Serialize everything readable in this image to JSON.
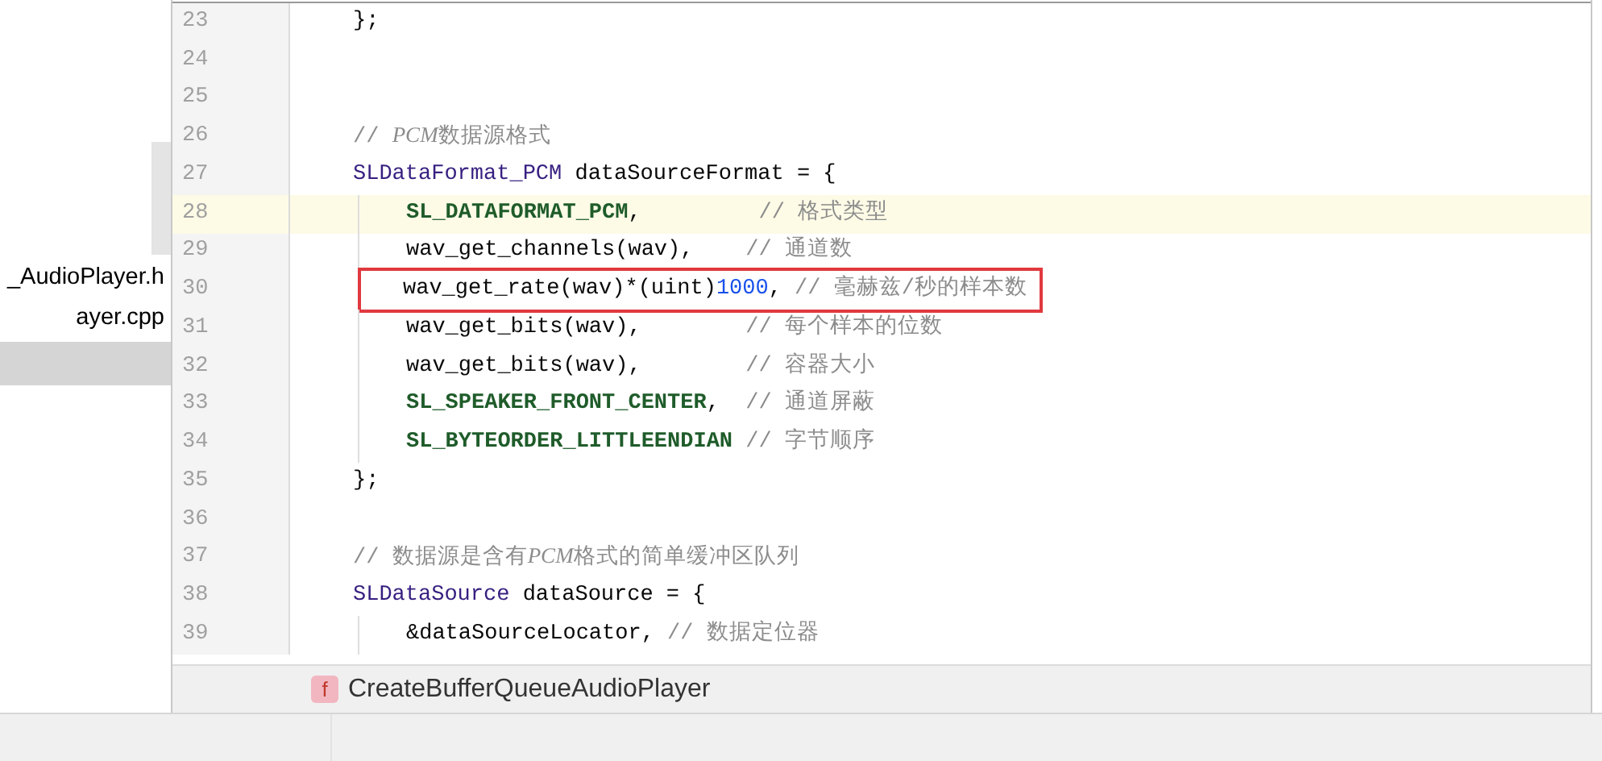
{
  "sidebar": {
    "items": [
      {
        "label": "_AudioPlayer.h",
        "selected": false
      },
      {
        "label": "ayer.cpp",
        "selected": false
      }
    ]
  },
  "editor": {
    "lines": [
      {
        "number": "23",
        "current": false,
        "tokens": [
          {
            "kind": "plain",
            "text": "};"
          }
        ]
      },
      {
        "number": "24",
        "current": false
      },
      {
        "number": "25",
        "current": false
      },
      {
        "number": "26",
        "current": false,
        "tokens": [
          {
            "kind": "comment",
            "text": "// "
          },
          {
            "kind": "comment_em",
            "text": "PCM"
          },
          {
            "kind": "comment",
            "text": "数据源格式"
          }
        ]
      },
      {
        "number": "27",
        "current": false,
        "tokens": [
          {
            "kind": "type",
            "text": "SLDataFormat_PCM"
          },
          {
            "kind": "plain",
            "text": " dataSourceFormat = {"
          }
        ],
        "children": [
          {
            "number": "28",
            "current": true,
            "tokens": [
              {
                "kind": "constant",
                "text": "SL_DATAFORMAT_PCM"
              },
              {
                "kind": "plain",
                "text": ",         "
              },
              {
                "kind": "comment",
                "text": "// 格式类型"
              }
            ]
          },
          {
            "number": "29",
            "current": false,
            "tokens": [
              {
                "kind": "plain",
                "text": "wav_get_channels(wav),    "
              },
              {
                "kind": "comment",
                "text": "// 通道数"
              }
            ]
          },
          {
            "number": "30",
            "current": false,
            "boxed": true,
            "tokens": [
              {
                "kind": "plain",
                "text": "wav_get_rate(wav)*(uint)"
              },
              {
                "kind": "number",
                "text": "1000"
              },
              {
                "kind": "plain",
                "text": ", "
              },
              {
                "kind": "comment",
                "text": "// 毫赫兹/秒的样本数"
              }
            ]
          },
          {
            "number": "31",
            "current": false,
            "tokens": [
              {
                "kind": "plain",
                "text": "wav_get_bits(wav),        "
              },
              {
                "kind": "comment",
                "text": "// 每个样本的位数"
              }
            ]
          },
          {
            "number": "32",
            "current": false,
            "tokens": [
              {
                "kind": "plain",
                "text": "wav_get_bits(wav),        "
              },
              {
                "kind": "comment",
                "text": "// 容器大小"
              }
            ]
          },
          {
            "number": "33",
            "current": false,
            "tokens": [
              {
                "kind": "constant",
                "text": "SL_SPEAKER_FRONT_CENTER"
              },
              {
                "kind": "plain",
                "text": ",  "
              },
              {
                "kind": "comment",
                "text": "// 通道屏蔽"
              }
            ]
          },
          {
            "number": "34",
            "current": false,
            "tokens": [
              {
                "kind": "constant",
                "text": "SL_BYTEORDER_LITTLEENDIAN"
              },
              {
                "kind": "comment",
                "text": " // 字节顺序"
              }
            ]
          }
        ]
      },
      {
        "number": "35",
        "current": false,
        "tokens": [
          {
            "kind": "plain",
            "text": "};"
          }
        ]
      },
      {
        "number": "36",
        "current": false
      },
      {
        "number": "37",
        "current": false,
        "tokens": [
          {
            "kind": "comment",
            "text": "// 数据源是含有"
          },
          {
            "kind": "comment_em",
            "text": "PCM"
          },
          {
            "kind": "comment",
            "text": "格式的简单缓冲区队列"
          }
        ]
      },
      {
        "number": "38",
        "current": false,
        "tokens": [
          {
            "kind": "type",
            "text": "SLDataSource"
          },
          {
            "kind": "plain",
            "text": " dataSource = {"
          }
        ],
        "children": [
          {
            "number": "39",
            "current": false,
            "tokens": [
              {
                "kind": "plain",
                "text": "&dataSourceLocator, "
              },
              {
                "kind": "comment",
                "text": "// 数据定位器"
              }
            ]
          }
        ]
      }
    ]
  },
  "breadcrumb": {
    "badge": "f",
    "label": "CreateBufferQueueAudioPlayer"
  }
}
